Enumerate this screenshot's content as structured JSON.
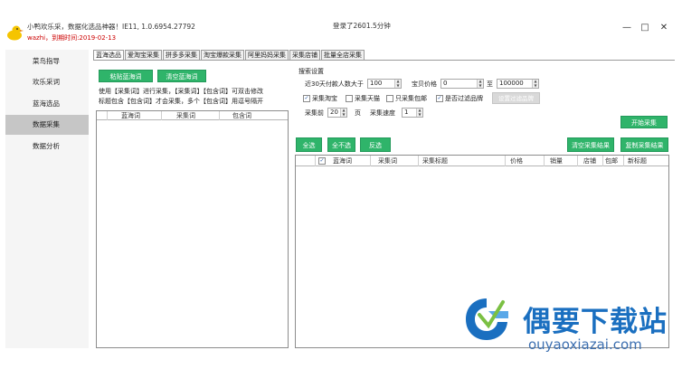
{
  "titlebar": {
    "app_title": "小鸭欢乐采，数据化选品神器！IE11, 1.0.6954.27792",
    "user_line": "wazhi，到期时间:2019-02-13",
    "login_info": "登录了2601.5分钟",
    "minimize_label": "—",
    "maximize_label": "□",
    "close_label": "✕"
  },
  "sidebar": {
    "items": [
      {
        "label": "菜鸟指导"
      },
      {
        "label": "欢乐采词"
      },
      {
        "label": "蓝海选品"
      },
      {
        "label": "数据采集"
      },
      {
        "label": "数据分析"
      }
    ],
    "active_index": 3
  },
  "tabs": [
    {
      "label": "蓝海选品"
    },
    {
      "label": "爱淘宝采集"
    },
    {
      "label": "拼多多采集"
    },
    {
      "label": "淘宝爆款采集"
    },
    {
      "label": "阿里妈妈采集"
    },
    {
      "label": "采集店铺"
    },
    {
      "label": "批量全店采集"
    }
  ],
  "left_panel": {
    "paste_button": "粘贴蓝海词",
    "clear_button": "清空蓝海词",
    "desc_line1": "使用【采集词】进行采集，【采集词】【包含词】可双击修改",
    "desc_line2": "标题包含【包含词】才会采集，多个【包含词】用逗号隔开",
    "columns": [
      "蓝海词",
      "采集词",
      "包含词"
    ]
  },
  "search_settings": {
    "group_title": "搜索设置",
    "buyers_label": "近30天付款人数大于",
    "buyers_value": "100",
    "price_label": "宝贝价格",
    "price_min": "0",
    "price_to": "至",
    "price_max": "100000",
    "checkboxes": [
      {
        "label": "采集淘宝",
        "checked": true
      },
      {
        "label": "采集天猫",
        "checked": false
      },
      {
        "label": "只采集包邮",
        "checked": false
      },
      {
        "label": "是否过滤品牌",
        "checked": true
      }
    ],
    "filter_brand_button": "设置过滤品牌",
    "pages_label_pre": "采集前",
    "pages_value": "20",
    "pages_label_post": "页",
    "speed_label": "采集速度",
    "speed_value": "1"
  },
  "actions": {
    "start_button": "开始采集",
    "select_all": "全选",
    "select_none": "全不选",
    "invert": "反选",
    "clear_results": "清空采集结果",
    "copy_results": "复制采集结果"
  },
  "results_table": {
    "columns": [
      "蓝海词",
      "采集词",
      "采集标题",
      "价格",
      "销量",
      "店铺",
      "包邮",
      "新标题"
    ],
    "header_checked": true
  },
  "watermark": {
    "title": "偶要下载站",
    "url": "ouyaoxiazai.com"
  },
  "colors": {
    "accent_green": "#2fb46a",
    "sidebar_active": "#c6c6c6",
    "watermark_blue": "#1a6fc0"
  }
}
